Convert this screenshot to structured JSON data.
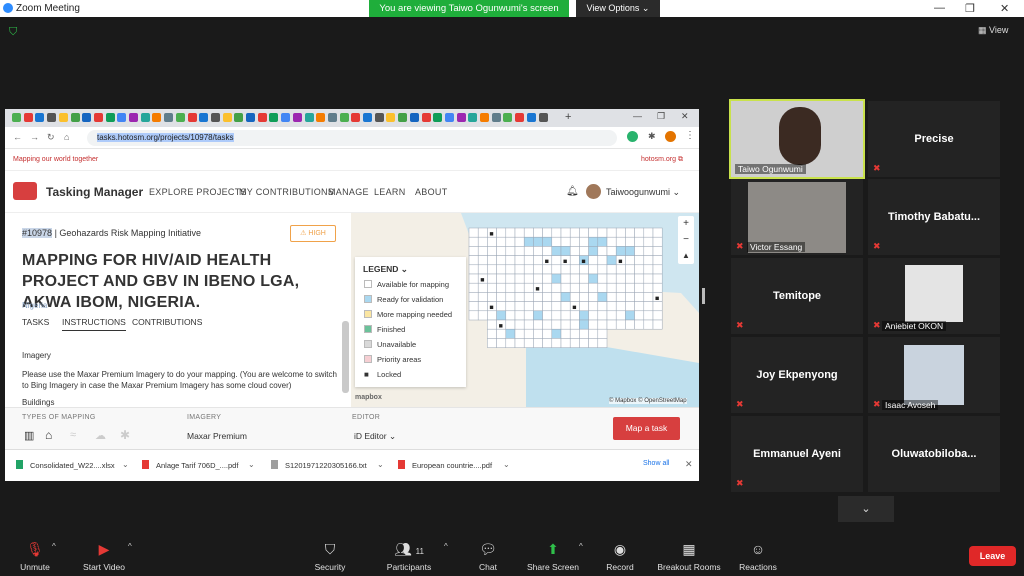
{
  "window": {
    "title": "Zoom Meeting",
    "share_banner": "You are viewing Taiwo Ogunwumi's screen",
    "view_options": "View Options",
    "view_button": "View"
  },
  "browser": {
    "url_prefix": "tasks.hotosm.org/projects/10978/tasks",
    "tagline": "Mapping our world together",
    "hot_link": "hotosm.org"
  },
  "tm": {
    "logo": "Tasking Manager",
    "nav": [
      "EXPLORE PROJECTS",
      "MY CONTRIBUTIONS",
      "MANAGE",
      "LEARN",
      "ABOUT"
    ],
    "user": "Taiwoogunwumi",
    "project_id": "#10978",
    "project_org": "| Geohazards Risk Mapping Initiative",
    "priority": "HIGH",
    "title": "MAPPING FOR HIV/AID HEALTH PROJECT AND GBV IN IBENO LGA, AKWA IBOM, NIGERIA.",
    "country": "Nigeria",
    "tabs": [
      "TASKS",
      "INSTRUCTIONS",
      "CONTRIBUTIONS"
    ],
    "imagery_heading": "Imagery",
    "imagery_text": "Please use the Maxar Premium Imagery to do your mapping. (You are welcome to switch to Bing Imagery in case the Maxar Premium Imagery has some cloud cover)",
    "buildings_heading": "Buildings",
    "legend": {
      "title": "LEGEND",
      "items": [
        {
          "label": "Available for mapping",
          "color": "#ffffff"
        },
        {
          "label": "Ready for validation",
          "color": "#aad8f0"
        },
        {
          "label": "More mapping needed",
          "color": "#fbe6a2"
        },
        {
          "label": "Finished",
          "color": "#6bc29a"
        },
        {
          "label": "Unavailable",
          "color": "#d9d9d9"
        },
        {
          "label": "Priority areas",
          "color": "#f6cfd3"
        },
        {
          "label": "Locked",
          "color": "lock-icon"
        }
      ]
    },
    "map_attribution": "© Mapbox © OpenStreetMap",
    "mapbox_logo": "mapbox",
    "bottom": {
      "types_label": "TYPES OF MAPPING",
      "imagery_label": "IMAGERY",
      "imagery_value": "Maxar Premium",
      "editor_label": "EDITOR",
      "editor_value": "iD Editor",
      "map_task": "Map a task"
    }
  },
  "downloads": {
    "items": [
      "Consolidated_W22....xlsx",
      "Anlage Tarif 706D_....pdf",
      "S120197122030516​6.txt",
      "European countrie....pdf"
    ],
    "show_all": "Show all"
  },
  "participants": [
    {
      "name": "Taiwo Ogunwumi",
      "video": true,
      "active": true
    },
    {
      "name": "Precise",
      "video": false
    },
    {
      "name": "Victor Essang",
      "video": true
    },
    {
      "name": "Timothy  Babatu...",
      "video": false
    },
    {
      "name": "Temitope",
      "video": false
    },
    {
      "name": "Aniebiet OKON",
      "video": true
    },
    {
      "name": "Joy Ekpenyong",
      "video": false
    },
    {
      "name": "Isaac Avoseh",
      "video": true
    },
    {
      "name": "Emmanuel Ayeni",
      "video": false
    },
    {
      "name": "Oluwatobiloba...",
      "video": false
    }
  ],
  "toolbar": {
    "unmute": "Unmute",
    "start_video": "Start Video",
    "security": "Security",
    "participants": "Participants",
    "participants_count": "11",
    "chat": "Chat",
    "share_screen": "Share Screen",
    "record": "Record",
    "breakout": "Breakout Rooms",
    "reactions": "Reactions",
    "leave": "Leave"
  }
}
